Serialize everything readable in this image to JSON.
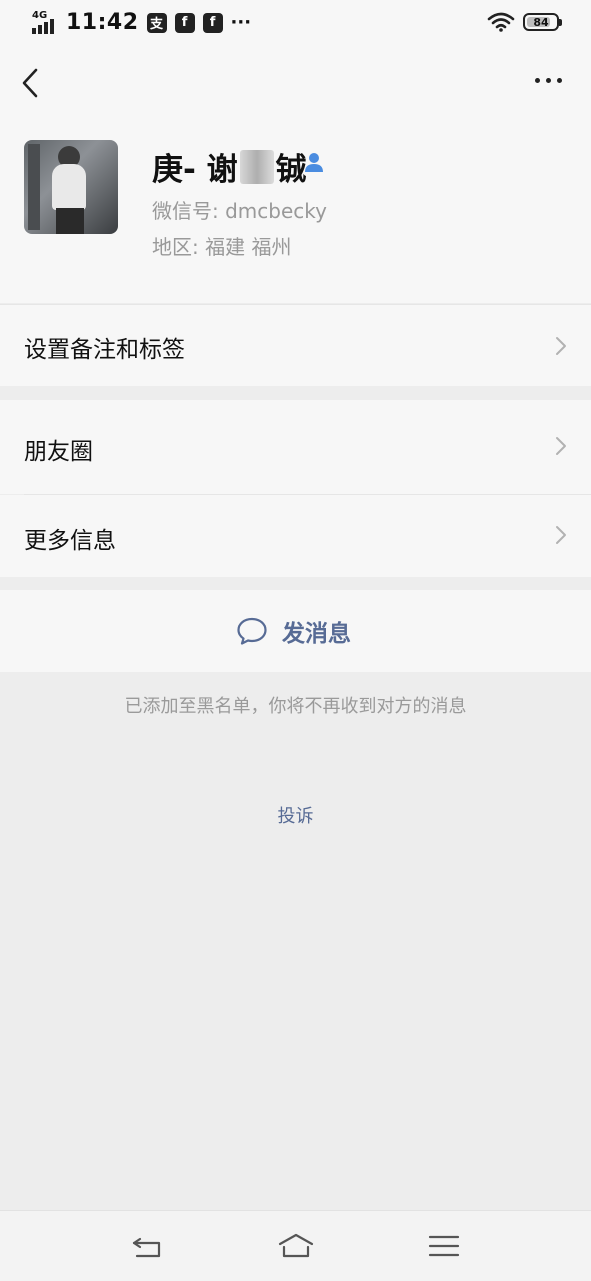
{
  "status_bar": {
    "network": "4G",
    "time": "11:42",
    "app_icons": [
      "支",
      "f",
      "f"
    ],
    "overflow": "···",
    "battery": "84"
  },
  "nav": {
    "back_icon": "chevron-left-icon",
    "more_icon": "more-dots-icon"
  },
  "profile": {
    "name_prefix": "庚- 谢",
    "name_suffix": "铖",
    "wechat_id": "微信号: dmcbecky",
    "region": "地区: 福建  福州"
  },
  "menu": {
    "remark_tags": "设置备注和标签",
    "moments": "朋友圈",
    "more_info": "更多信息"
  },
  "actions": {
    "send_message": "发消息"
  },
  "notices": {
    "blacklisted": "已添加至黑名单，你将不再收到对方的消息",
    "complain": "投诉"
  },
  "colors": {
    "link_blue": "#576b95",
    "background": "#ededed",
    "surface": "#f7f7f7"
  }
}
